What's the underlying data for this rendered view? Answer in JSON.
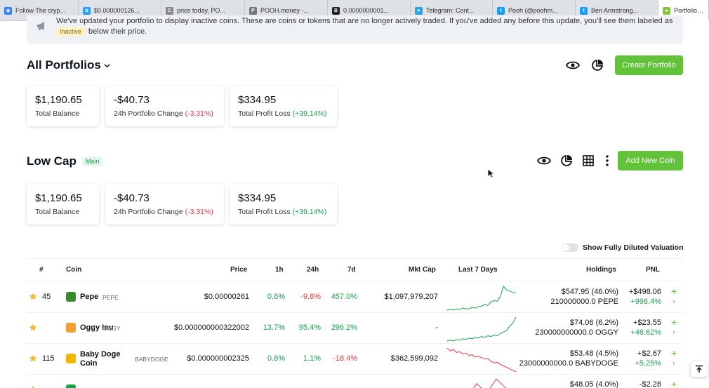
{
  "browser": {
    "tabs": [
      {
        "title": "Follow The cryp...",
        "color": "#3b82f6",
        "glyph": "◉"
      },
      {
        "title": "$0.000000126...",
        "color": "#2a9df4",
        "glyph": "≋"
      },
      {
        "title": "price today, PO...",
        "color": "#888888",
        "glyph": "C"
      },
      {
        "title": "POOH.money -...",
        "color": "#777777",
        "glyph": "P"
      },
      {
        "title": "0.0000000001...",
        "color": "#222222",
        "glyph": "B"
      },
      {
        "title": "Telegram: Cont...",
        "color": "#2aa3df",
        "glyph": "➤"
      },
      {
        "title": "Pooh (@poohm...",
        "color": "#1d9bf0",
        "glyph": "t"
      },
      {
        "title": "Ben Armstrong...",
        "color": "#1d9bf0",
        "glyph": "t"
      },
      {
        "title": "Portfolio Over",
        "color": "#8bc34a",
        "glyph": "●"
      }
    ]
  },
  "notice": {
    "line1": "We've updated your portfolio to display inactive coins. These are coins or tokens that are no longer actively traded. If you've added any before this update, you'll see them labeled as",
    "badge": "Inactive",
    "line2": "below their price."
  },
  "all_portfolios": {
    "title": "All Portfolios",
    "create_label": "Create Portfolio",
    "cards": {
      "balance_value": "$1,190.65",
      "balance_label": "Total Balance",
      "change_value": "-$40.73",
      "change_label": "24h Portfolio Change",
      "change_pct": "(-3.31%)",
      "pl_value": "$334.95",
      "pl_label": "Total Profit Loss",
      "pl_pct": "(+39.14%)"
    }
  },
  "low_cap": {
    "title": "Low Cap",
    "badge": "Main",
    "add_label": "Add New Coin",
    "cards": {
      "balance_value": "$1,190.65",
      "balance_label": "Total Balance",
      "change_value": "-$40.73",
      "change_label": "24h Portfolio Change",
      "change_pct": "(-3.31%)",
      "pl_value": "$334.95",
      "pl_label": "Total Profit Loss",
      "pl_pct": "(+39.14%)"
    }
  },
  "fdv_toggle_label": "Show Fully Diluted Valuation",
  "table": {
    "headers": {
      "rank": "#",
      "coin": "Coin",
      "price": "Price",
      "h1": "1h",
      "h24": "24h",
      "d7": "7d",
      "mcap": "Mkt Cap",
      "last7": "Last 7 Days",
      "holdings": "Holdings",
      "pnl": "PNL"
    },
    "rows": [
      {
        "rank": "45",
        "name": "Pepe",
        "symbol": "PEPE",
        "price": "$0.00000261",
        "h1": "0.6%",
        "h24": "-9.8%",
        "d7": "457.0%",
        "mcap": "$1,097,979,207",
        "holdings_value": "$547.95 (46.0%)",
        "holdings_amount": "210000000.0 PEPE",
        "pnl_value": "+$498.06",
        "pnl_pct": "+998.4%",
        "spark": [
          10,
          11,
          10,
          12,
          11,
          13,
          12,
          12,
          14,
          13,
          15,
          16,
          18,
          17,
          22,
          24,
          23,
          30,
          45,
          40,
          38,
          36,
          35
        ],
        "spark_color": "#16a34a",
        "logo_color": "#3a8a2e"
      },
      {
        "rank": "",
        "name": "Oggy Inu",
        "symbol": "OGGY",
        "price": "$0.000000000322002",
        "h1": "13.7%",
        "h24": "95.4%",
        "d7": "296.2%",
        "mcap": "-",
        "holdings_value": "$74.06 (6.2%)",
        "holdings_amount": "230000000000.0 OGGY",
        "pnl_value": "+$23.55",
        "pnl_pct": "+46.62%",
        "spark": [
          8,
          9,
          8,
          10,
          9,
          11,
          10,
          12,
          11,
          13,
          12,
          14,
          13,
          15,
          14,
          16,
          15,
          18,
          20,
          22,
          28,
          32,
          40
        ],
        "spark_color": "#16a34a",
        "logo_color": "#f0a030"
      },
      {
        "rank": "115",
        "name": "Baby Doge Coin",
        "symbol": "BABYDOGE",
        "price": "$0.000000002325",
        "h1": "0.8%",
        "h24": "1.1%",
        "d7": "-18.4%",
        "mcap": "$362,599,092",
        "holdings_value": "$53.48 (4.5%)",
        "holdings_amount": "23000000000.0 BABYDOGE",
        "pnl_value": "+$2.67",
        "pnl_pct": "+5.25%",
        "spark": [
          40,
          36,
          38,
          34,
          35,
          32,
          33,
          30,
          31,
          28,
          29,
          27,
          25,
          26,
          22,
          20,
          21,
          18,
          16,
          14,
          12,
          10,
          8
        ],
        "spark_color": "#ea3943",
        "logo_color": "#f5b400"
      },
      {
        "rank": "",
        "name": "",
        "symbol": "",
        "price": "",
        "h1": "",
        "h24": "",
        "d7": "",
        "mcap": "",
        "holdings_value": "$48.05 (4.0%)",
        "holdings_amount": "",
        "pnl_value": "-$2.28",
        "pnl_pct": "",
        "spark": [
          20,
          35,
          25,
          40,
          30,
          45,
          35,
          30
        ],
        "spark_color": "#ea3943",
        "logo_color": "#16a34a"
      }
    ]
  }
}
